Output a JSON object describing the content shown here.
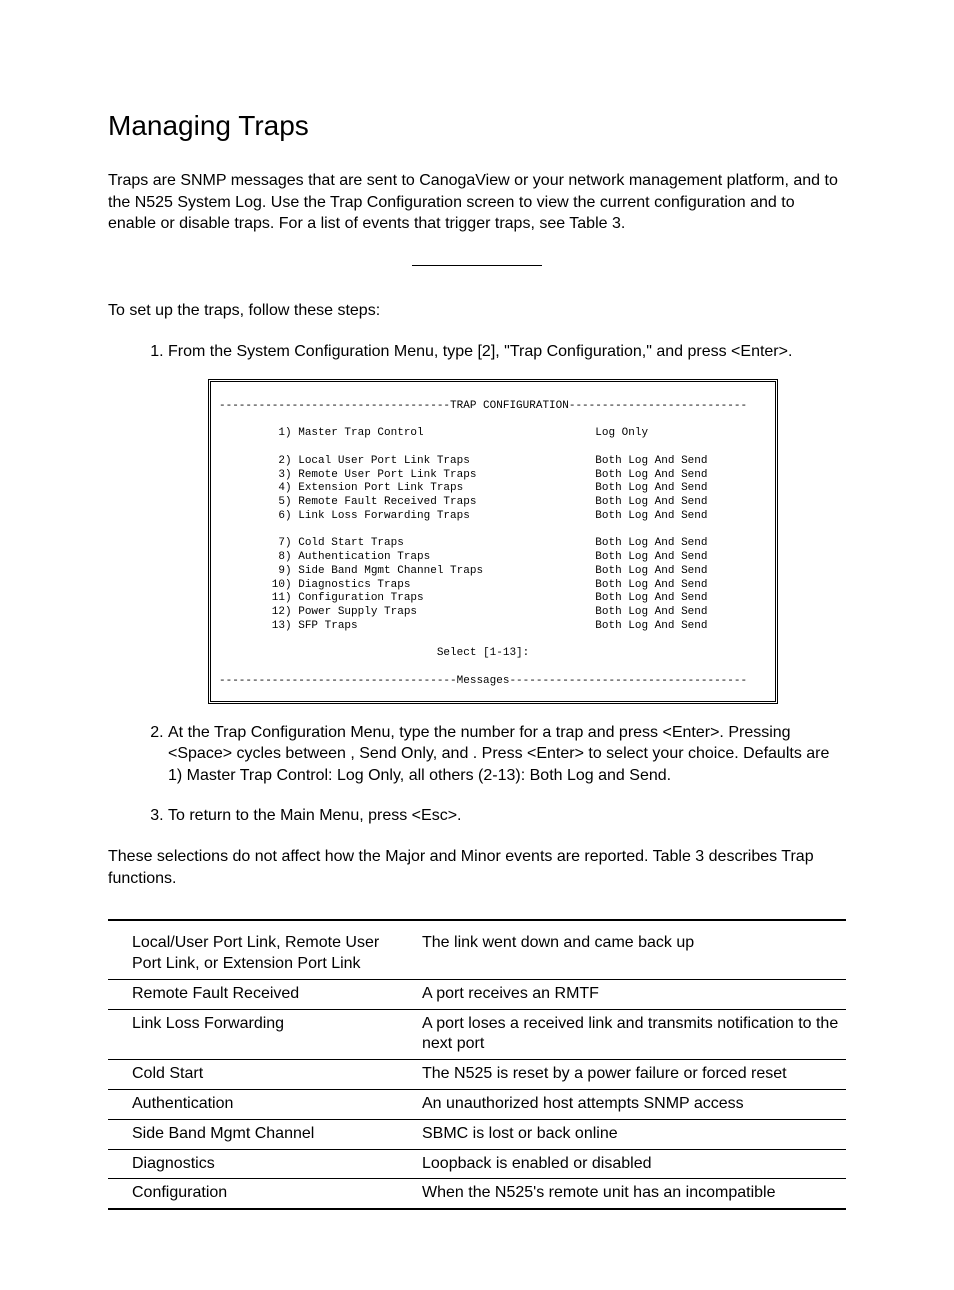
{
  "title": "Managing Traps",
  "intro": "Traps are SNMP messages that are sent to CanogaView or your network management platform, and to the N525 System Log. Use the Trap Configuration screen to view the current configuration and to enable or disable traps. For a list of events that trigger traps, see Table 3.",
  "setup_intro": "To set up the traps, follow these steps:",
  "steps": {
    "s1_a": "From the System Configuration Menu, type [",
    "s1_key": "2",
    "s1_b": "], \"Trap Configuration,\" and press <Enter>.",
    "s2": "At the Trap Configuration Menu, type the number for a trap and press <Enter>. Pressing <Space> cycles between              , Send Only,                                  and              . Press <Enter> to select your choice. Defaults are 1) Master Trap Control: Log Only, all others (2-13): Both Log and Send.",
    "s3": "To return to the Main Menu, press <Esc>."
  },
  "terminal": "-----------------------------------TRAP CONFIGURATION---------------------------\n\n         1) Master Trap Control                          Log Only\n\n         2) Local User Port Link Traps                   Both Log And Send\n         3) Remote User Port Link Traps                  Both Log And Send\n         4) Extension Port Link Traps                    Both Log And Send\n         5) Remote Fault Received Traps                  Both Log And Send\n         6) Link Loss Forwarding Traps                   Both Log And Send\n\n         7) Cold Start Traps                             Both Log And Send\n         8) Authentication Traps                         Both Log And Send\n         9) Side Band Mgmt Channel Traps                 Both Log And Send\n        10) Diagnostics Traps                            Both Log And Send\n        11) Configuration Traps                          Both Log And Send\n        12) Power Supply Traps                           Both Log And Send\n        13) SFP Traps                                    Both Log And Send\n\n                                 Select [1-13]:\n\n------------------------------------Messages------------------------------------\n",
  "post_table_intro": "These selections do not affect how the Major and Minor events are reported. Table 3 describes Trap functions.",
  "table_rows": [
    {
      "trap": "Local/User Port Link, Remote User Port Link, or Extension Port Link",
      "desc": "The link went down and came back up"
    },
    {
      "trap": "Remote Fault Received",
      "desc": "A port receives an RMTF"
    },
    {
      "trap": "Link Loss Forwarding",
      "desc": "A port loses a received link and transmits notification to the next port"
    },
    {
      "trap": "Cold Start",
      "desc": "The N525 is reset by a power failure or forced reset"
    },
    {
      "trap": "Authentication",
      "desc": "An unauthorized host attempts SNMP access"
    },
    {
      "trap": "Side Band Mgmt Channel",
      "desc": "SBMC is lost or back online"
    },
    {
      "trap": "Diagnostics",
      "desc": "Loopback is enabled or disabled"
    },
    {
      "trap": "Configuration",
      "desc": "When the N525's remote unit has an incompatible"
    }
  ]
}
